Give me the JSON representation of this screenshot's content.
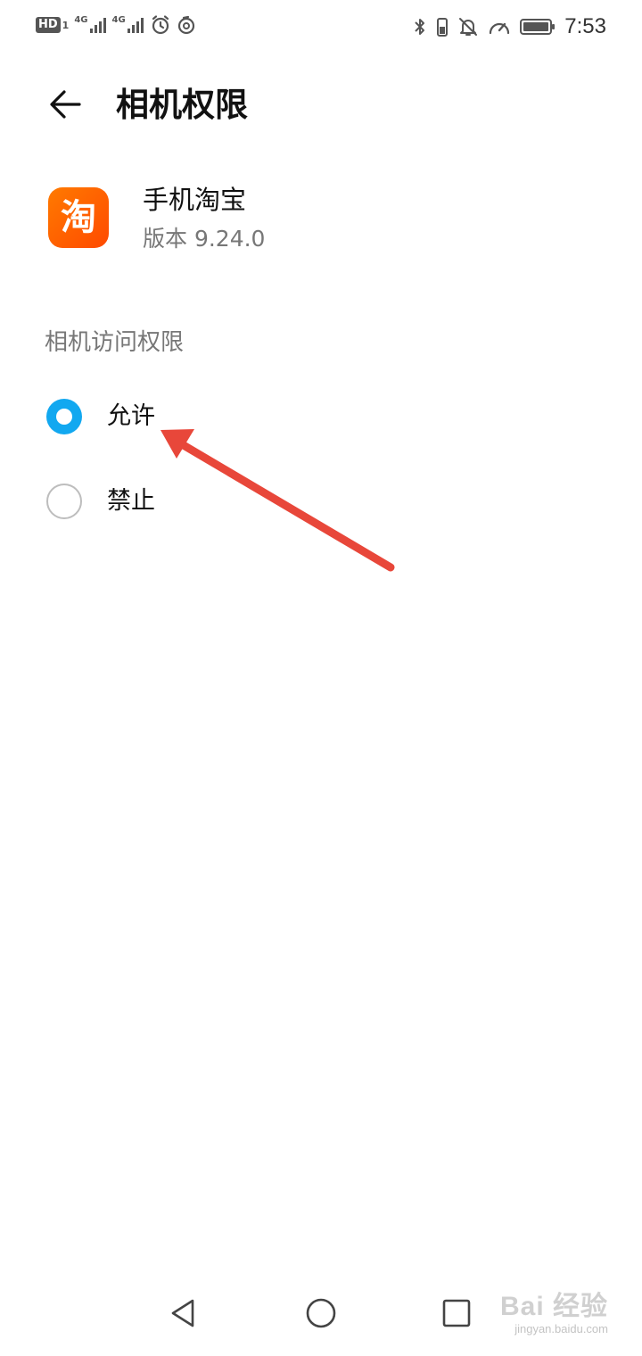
{
  "status_bar": {
    "hd_label": "HD",
    "sim_slot": "1",
    "network_1": "4G",
    "network_2": "4G",
    "time": "7:53"
  },
  "header": {
    "title": "相机权限"
  },
  "app": {
    "icon_glyph": "淘",
    "name": "手机淘宝",
    "version": "版本 9.24.0"
  },
  "section": {
    "label": "相机访问权限"
  },
  "options": [
    {
      "label": "允许",
      "checked": true
    },
    {
      "label": "禁止",
      "checked": false
    }
  ],
  "watermark": {
    "main": "Bai 经验",
    "sub": "jingyan.baidu.com"
  },
  "colors": {
    "accent": "#12a8f0",
    "annotation_arrow": "#e8473a",
    "app_icon": "#ff5a00"
  }
}
